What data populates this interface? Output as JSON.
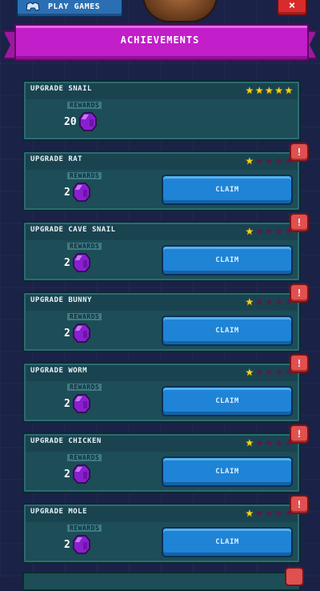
{
  "top_bar": {
    "play_games_label": "PLAY GAMES",
    "close_label": "×",
    "close_icon": "close-icon",
    "play_games_icon": "controller-icon"
  },
  "header": {
    "title": "ACHIEVEMENTS"
  },
  "colors": {
    "banner": "#c21ec9",
    "card": "#1d4d57",
    "claim_button": "#1f84d6",
    "star_on": "#f2d21b",
    "star_off": "#5a1a4a",
    "alert": "#e05050",
    "gem": "#9b2bd6"
  },
  "achievements": [
    {
      "title": "UPGRADE SNAIL",
      "stars": 5,
      "max_stars": 5,
      "rewards_label": "REWARDS",
      "reward_amount": "20",
      "reward_icon": "gem-icon",
      "claim_label": "",
      "claimable": false,
      "alert": ""
    },
    {
      "title": "UPGRADE RAT",
      "stars": 1,
      "max_stars": 5,
      "rewards_label": "REWARDS",
      "reward_amount": "2",
      "reward_icon": "gem-icon",
      "claim_label": "CLAIM",
      "claimable": true,
      "alert": "!"
    },
    {
      "title": "UPGRADE CAVE SNAIL",
      "stars": 1,
      "max_stars": 5,
      "rewards_label": "REWARDS",
      "reward_amount": "2",
      "reward_icon": "gem-icon",
      "claim_label": "CLAIM",
      "claimable": true,
      "alert": "!"
    },
    {
      "title": "UPGRADE BUNNY",
      "stars": 1,
      "max_stars": 5,
      "rewards_label": "REWARDS",
      "reward_amount": "2",
      "reward_icon": "gem-icon",
      "claim_label": "CLAIM",
      "claimable": true,
      "alert": "!"
    },
    {
      "title": "UPGRADE WORM",
      "stars": 1,
      "max_stars": 5,
      "rewards_label": "REWARDS",
      "reward_amount": "2",
      "reward_icon": "gem-icon",
      "claim_label": "CLAIM",
      "claimable": true,
      "alert": "!"
    },
    {
      "title": "UPGRADE CHICKEN",
      "stars": 1,
      "max_stars": 5,
      "rewards_label": "REWARDS",
      "reward_amount": "2",
      "reward_icon": "gem-icon",
      "claim_label": "CLAIM",
      "claimable": true,
      "alert": "!"
    },
    {
      "title": "UPGRADE MOLE",
      "stars": 1,
      "max_stars": 5,
      "rewards_label": "REWARDS",
      "reward_amount": "2",
      "reward_icon": "gem-icon",
      "claim_label": "CLAIM",
      "claimable": true,
      "alert": "!"
    }
  ]
}
